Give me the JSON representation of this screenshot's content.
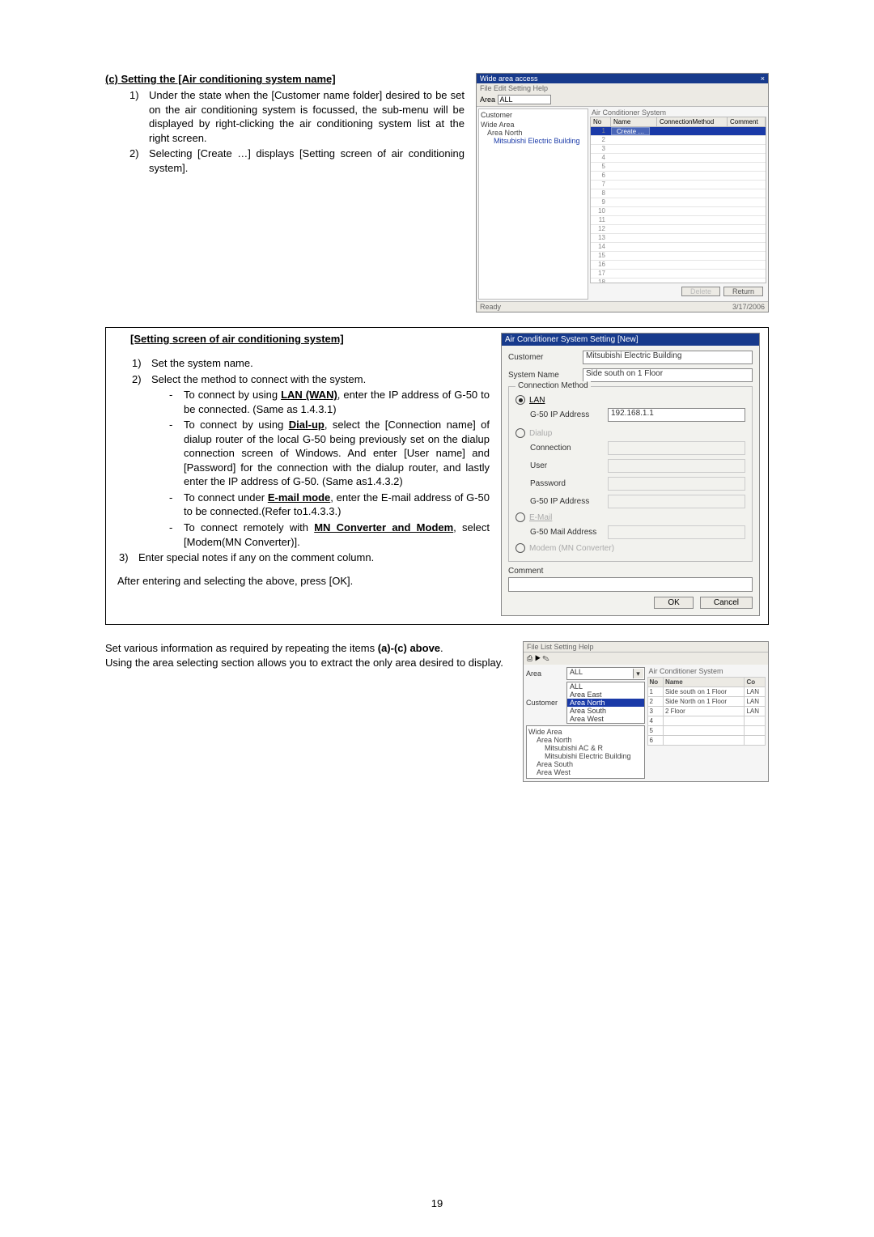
{
  "pageNumber": "19",
  "secC": {
    "heading": "(c) Setting the [Air conditioning system name]",
    "items": [
      {
        "n": "1)",
        "text": "Under the state when the [Customer name folder] desired to be set on the air conditioning system is focussed, the sub-menu will be displayed by right-clicking the air conditioning system list at the right screen."
      },
      {
        "n": "2)",
        "text": "Selecting [Create …] displays [Setting screen of air conditioning system]."
      }
    ]
  },
  "winTop": {
    "title": "Wide area access",
    "closeX": "×",
    "menus": "File  Edit  Setting  Help",
    "areaLabel": "Area",
    "areaValue": "ALL",
    "customerLabel": "Customer",
    "treeRoot": "Wide Area",
    "treeChild": "Area North",
    "treeLeaf": "Mitsubishi Electric Building",
    "rightHeader": "Air Conditioner System",
    "cols": [
      "No",
      "Name",
      "ConnectionMethod",
      "Comment"
    ],
    "blueRowNo": "1",
    "blueRowLabel": "Create …",
    "deleteBtn": "Delete",
    "returnBtn": "Return",
    "statusLeft": "Ready",
    "statusRight": "3/17/2006"
  },
  "settingPanel": {
    "heading": "[Setting screen of air conditioning system]",
    "step1": {
      "n": "1)",
      "text": "Set the system name."
    },
    "step2": {
      "n": "2)",
      "text": "Select the method to connect with the system."
    },
    "bullets": [
      {
        "pre": "To connect by using ",
        "bold": "LAN (WAN)",
        "post": ", enter the IP address of G-50 to be connected. (Same as 1.4.3.1)"
      },
      {
        "pre": "To connect by using ",
        "bold": "Dial-up",
        "post": ", select the [Connection name] of dialup router of the local G-50 being previously set on the dialup connection screen of Windows. And enter [User name] and [Password] for the connection with the dialup router, and lastly enter the IP address of G-50. (Same as1.4.3.2)"
      },
      {
        "pre": "To connect under ",
        "bold": "E-mail mode",
        "post": ", enter the E-mail address of G-50 to be connected.(Refer to1.4.3.3.)"
      },
      {
        "pre": "To connect remotely with ",
        "bold": "MN Converter and Modem",
        "post": ", select [Modem(MN Converter)]."
      }
    ],
    "step3": {
      "n": "3)",
      "text": "Enter special notes if any on the comment column."
    },
    "after": "After entering and selecting the above, press [OK]."
  },
  "dlg": {
    "title": "Air Conditioner System Setting [New]",
    "customerLabel": "Customer",
    "customerValue": "Mitsubishi Electric Building",
    "systemLabel": "System Name",
    "systemValue": "Side south on 1 Floor",
    "connLegend": "Connection Method",
    "lan": {
      "label": "LAN",
      "ipLabel": "G-50 IP Address",
      "ipValue": "192.168.1.1"
    },
    "dialup": {
      "label": "Dialup",
      "connectionLabel": "Connection",
      "userLabel": "User",
      "passwordLabel": "Password",
      "ipLabel": "G-50 IP Address"
    },
    "email": {
      "label": "E-Mail",
      "addrLabel": "G-50 Mail Address"
    },
    "modem": {
      "label": "Modem (MN Converter)"
    },
    "commentLabel": "Comment",
    "ok": "OK",
    "cancel": "Cancel"
  },
  "bottomText1": "Set various information as required by repeating the items ",
  "bottomBold": "(a)-(c) above",
  "bottomText1b": ".",
  "bottomText2": "Using the area selecting section allows you to extract the only area desired to display.",
  "winSmall": {
    "menus": "File  List  Setting  Help",
    "areaLabel": "Area",
    "areaValue": "ALL",
    "customerLabel": "Customer",
    "dropOptions": [
      "ALL",
      "Area East",
      "Area North",
      "Area South",
      "Area West"
    ],
    "dropSelectedIndex": 2,
    "treeRoot": "Wide Area",
    "treeNodes": [
      "Area North",
      "Mitsubishi AC & R",
      "Mitsubishi Electric Building",
      "Area South",
      "Area West"
    ],
    "listHeader": "Air Conditioner System",
    "cols": [
      "No",
      "Name",
      "Co"
    ],
    "rows": [
      {
        "no": "1",
        "name": "Side south on 1 Floor",
        "co": "LAN"
      },
      {
        "no": "2",
        "name": "Side North on 1 Floor",
        "co": "LAN"
      },
      {
        "no": "3",
        "name": "2 Floor",
        "co": "LAN"
      },
      {
        "no": "4",
        "name": "",
        "co": ""
      },
      {
        "no": "5",
        "name": "",
        "co": ""
      },
      {
        "no": "6",
        "name": "",
        "co": ""
      }
    ]
  }
}
